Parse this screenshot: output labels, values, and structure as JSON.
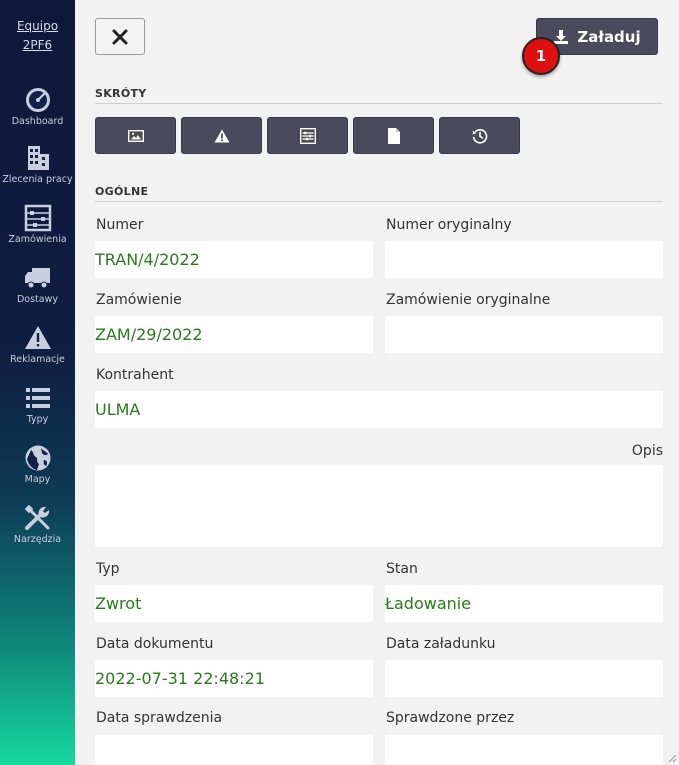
{
  "sidebar": {
    "user": [
      "Equipo",
      "2PF6"
    ],
    "items": [
      {
        "label": "Dashboard",
        "icon": "gauge-icon"
      },
      {
        "label": "Zlecenia pracy",
        "icon": "building-icon"
      },
      {
        "label": "Zamówienia",
        "icon": "abacus-icon"
      },
      {
        "label": "Dostawy",
        "icon": "truck-icon"
      },
      {
        "label": "Reklamacje",
        "icon": "warning-icon"
      },
      {
        "label": "Typy",
        "icon": "list-icon"
      },
      {
        "label": "Mapy",
        "icon": "globe-icon"
      },
      {
        "label": "Narzędzia",
        "icon": "tools-icon"
      }
    ]
  },
  "toolbar": {
    "close_icon": "close-icon",
    "load_label": "Załaduj",
    "badge": "1"
  },
  "shortcuts": {
    "title": "SKRÓTY",
    "buttons": [
      "image-icon",
      "warning-icon",
      "checklist-icon",
      "document-icon",
      "history-icon"
    ]
  },
  "general": {
    "title": "OGÓLNE",
    "numer_label": "Numer",
    "numer_value": "TRAN/4/2022",
    "numer_oryg_label": "Numer oryginalny",
    "numer_oryg_value": "",
    "zamowienie_label": "Zamówienie",
    "zamowienie_value": "ZAM/29/2022",
    "zamowienie_oryg_label": "Zamówienie oryginalne",
    "zamowienie_oryg_value": "",
    "kontrahent_label": "Kontrahent",
    "kontrahent_value": "ULMA",
    "opis_label": "Opis",
    "typ_label": "Typ",
    "typ_value": "Zwrot",
    "stan_label": "Stan",
    "stan_value": "Ładowanie",
    "data_dok_label": "Data dokumentu",
    "data_dok_value": "2022-07-31 22:48:21",
    "data_zal_label": "Data załadunku",
    "data_zal_value": "",
    "data_spr_label": "Data sprawdzenia",
    "data_spr_value": "",
    "spr_przez_label": "Sprawdzone przez",
    "spr_przez_value": ""
  }
}
